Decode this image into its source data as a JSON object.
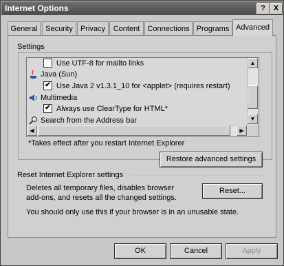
{
  "window": {
    "title": "Internet Options",
    "help_label": "?",
    "close_label": "X"
  },
  "tabs": [
    {
      "label": "General"
    },
    {
      "label": "Security"
    },
    {
      "label": "Privacy"
    },
    {
      "label": "Content"
    },
    {
      "label": "Connections"
    },
    {
      "label": "Programs"
    },
    {
      "label": "Advanced"
    }
  ],
  "settings": {
    "group_label": "Settings",
    "items": [
      {
        "type": "checkbox",
        "label": "Use UTF-8 for mailto links",
        "checked": false
      },
      {
        "type": "category",
        "label": "Java (Sun)",
        "icon": "java-icon"
      },
      {
        "type": "checkbox",
        "label": "Use Java 2 v1.3.1_10 for <applet> (requires restart)",
        "checked": true
      },
      {
        "type": "category",
        "label": "Multimedia",
        "icon": "multimedia-icon"
      },
      {
        "type": "checkbox",
        "label": "Always use ClearType for HTML*",
        "checked": true
      },
      {
        "type": "category",
        "label": "Search from the Address bar",
        "icon": "search-icon"
      }
    ]
  },
  "note": "*Takes effect after you restart Internet Explorer",
  "restore_button": "Restore advanced settings",
  "reset": {
    "heading": "Reset Internet Explorer settings",
    "description_line1": "Deletes all temporary files, disables browser",
    "description_line2": "add-ons, and resets all the changed settings.",
    "warning": "You should only use this if your browser is in an unusable state.",
    "button": "Reset..."
  },
  "footer": {
    "ok": "OK",
    "cancel": "Cancel",
    "apply": "Apply"
  }
}
